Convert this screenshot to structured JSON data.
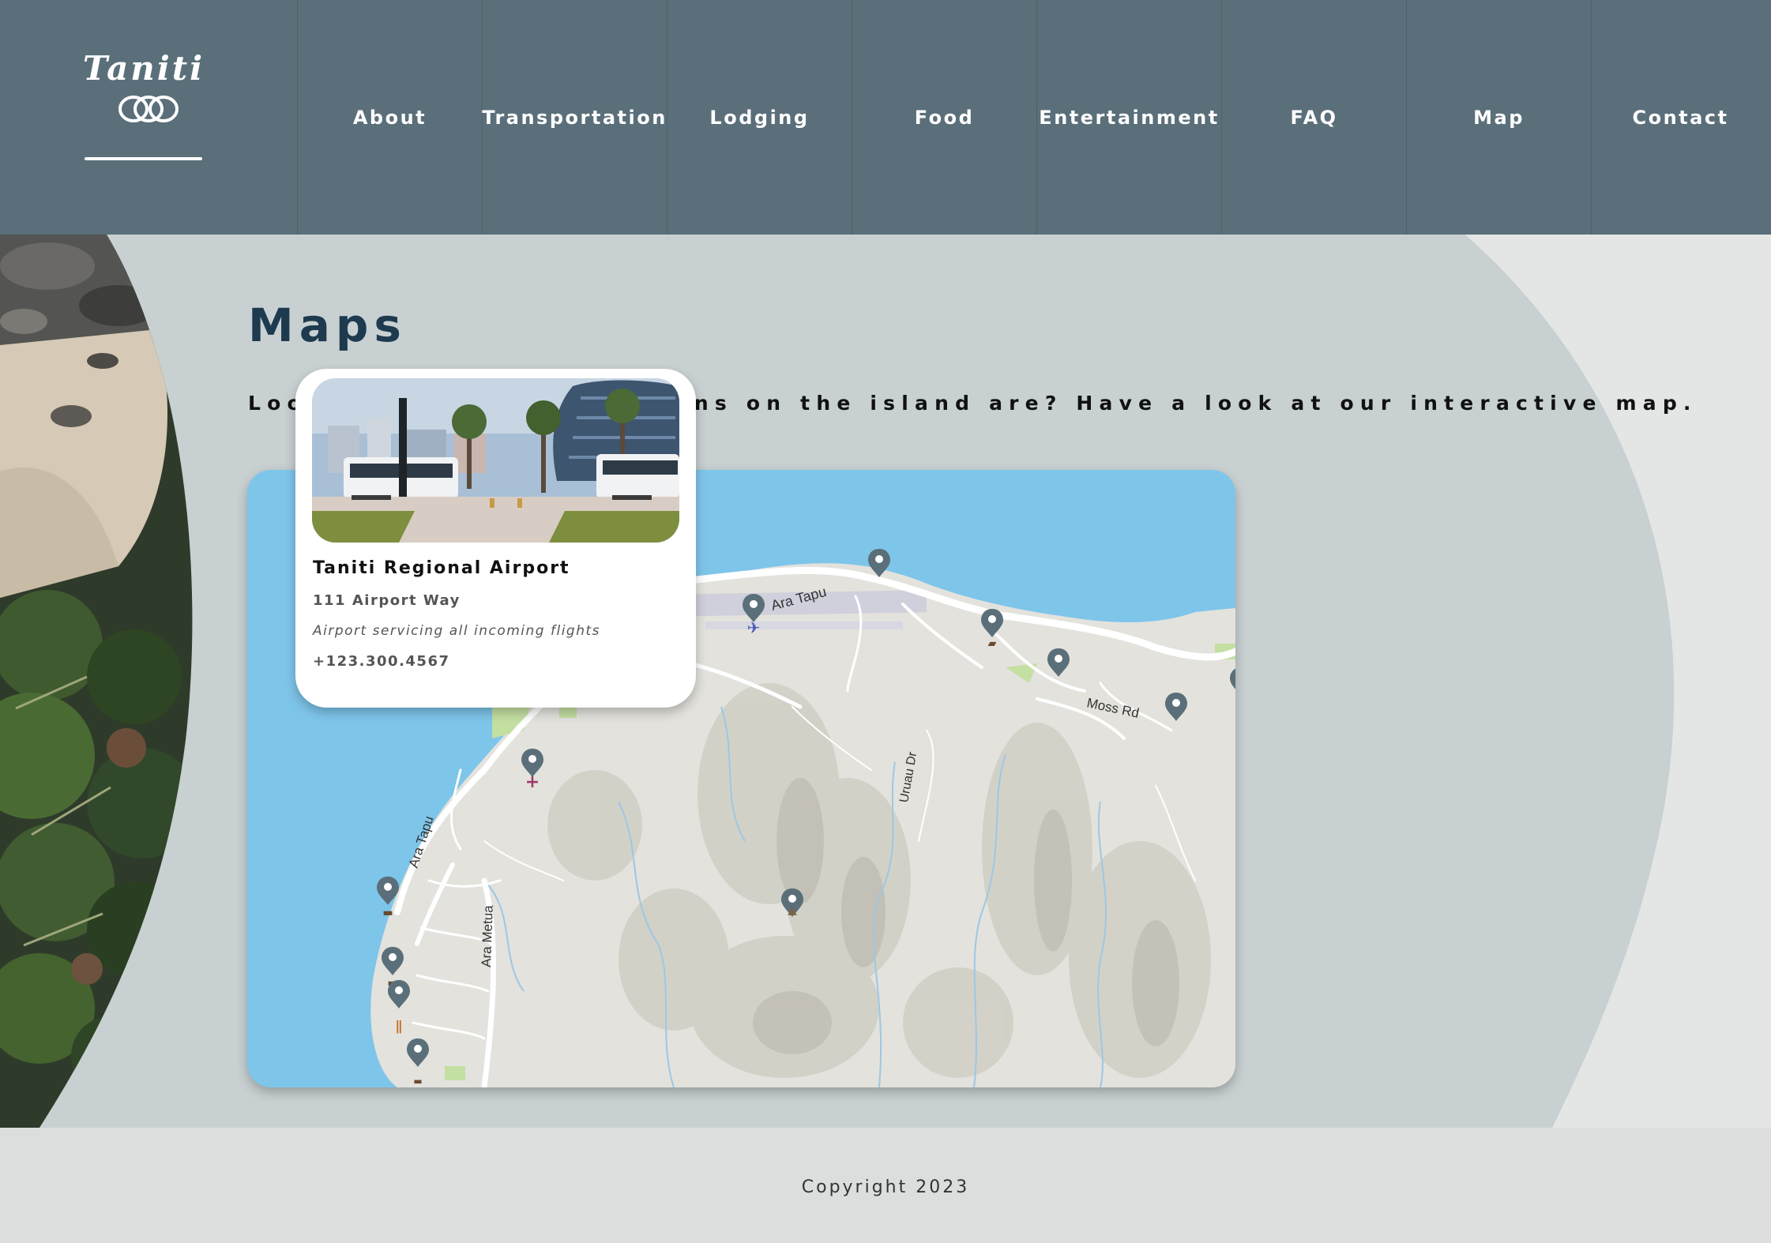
{
  "nav": {
    "logo_text": "Taniti",
    "links": [
      "About",
      "Transportation",
      "Lodging",
      "Food",
      "Entertainment",
      "FAQ",
      "Map",
      "Contact"
    ]
  },
  "main": {
    "title": "Maps",
    "intro": "Looking for where locations on the island are? Have a look at our interactive map."
  },
  "map": {
    "road_labels": [
      "Ara Tapu",
      "Moss Rd",
      "Ara Tapu",
      "Ara Metua",
      "Uruau Dr"
    ],
    "popup": {
      "title": "Taniti Regional Airport",
      "address": "111 Airport Way",
      "description": "Airport servicing all incoming flights",
      "phone": "+123.300.4567"
    },
    "marker_icons": [
      "airport-icon",
      "hospital-icon",
      "shopping-cart-icon",
      "bed-icon",
      "restaurant-icon",
      "mountain-icon"
    ]
  },
  "footer": {
    "copyright": "Copyright 2023"
  },
  "colors": {
    "nav_bg": "#5a6f79",
    "main_bg": "#c8d0d1",
    "water": "#7ec5ea",
    "land": "#e2e1dc",
    "marker": "#5a6f79",
    "title": "#1e3a4f"
  }
}
